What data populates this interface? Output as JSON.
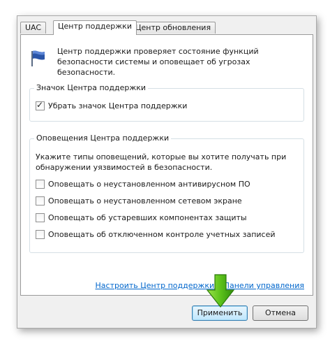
{
  "tabs": [
    {
      "label": "UAC"
    },
    {
      "label": "Центр поддержки"
    },
    {
      "label": "Центр обновления"
    }
  ],
  "intro": {
    "line1": "Центр поддержки проверяет состояние функций",
    "line2": "безопасности системы и оповещает об угрозах безопасности."
  },
  "icon_group": {
    "title": "Значок Центра поддержки",
    "checkbox_label": "Убрать значок Центра поддержки",
    "checked": true
  },
  "alerts_group": {
    "title": "Оповещения Центра поддержки",
    "desc_line1": "Укажите типы оповещений, которые вы хотите получать при",
    "desc_line2": "обнаружении уязвимостей в безопасности.",
    "options": [
      {
        "label": "Оповещать о неустановленном антивирусном ПО",
        "checked": false
      },
      {
        "label": "Оповещать о неустановленном сетевом экране",
        "checked": false
      },
      {
        "label": "Оповещать об устаревших компонентах защиты",
        "checked": false
      },
      {
        "label": "Оповещать об отключенном контроле учетных записей",
        "checked": false
      }
    ]
  },
  "link_text": "Настроить Центр поддержки в Панели управления",
  "buttons": {
    "apply": "Применить",
    "cancel": "Отмена"
  },
  "colors": {
    "link": "#0066cc",
    "arrow": "#5cc21a",
    "flag": "#2a55a8"
  }
}
